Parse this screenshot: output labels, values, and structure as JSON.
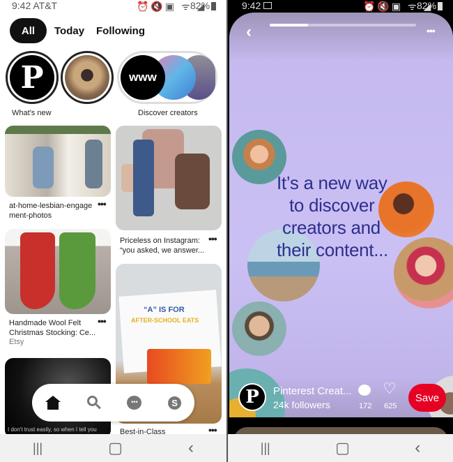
{
  "left": {
    "status": {
      "time": "9:42 AT&T",
      "battery": "82%"
    },
    "tabs": [
      {
        "label": "All",
        "active": true
      },
      {
        "label": "Today"
      },
      {
        "label": "Following"
      }
    ],
    "stories": [
      {
        "label": "What's new"
      },
      {
        "label": ""
      },
      {
        "label": "Discover creators",
        "logo_text": "www"
      }
    ],
    "pins": [
      {
        "title": "at-home-lesbian-engagement-photos",
        "line1": "at-home-lesbian-engage",
        "line2": "ment-photos"
      },
      {
        "line1": "Priceless on Instagram:",
        "line2": "“you asked, we answer..."
      },
      {
        "line1": "Handmade Wool Felt",
        "line2": "Christmas Stocking: Ce...",
        "source": "Etsy"
      },
      {
        "line1": "Best-in-Class"
      },
      {
        "caption": "I don't trust easily, so when I tell you"
      }
    ],
    "more_label": "•••",
    "card_text": {
      "a": "“A” IS FOR",
      "b": "AFTER-SCHOOL EATS"
    },
    "bottom_nav": [
      "home-icon",
      "search-icon",
      "chat-icon",
      "profile-icon"
    ],
    "profile_initial": "S"
  },
  "right": {
    "status": {
      "time": "9:42",
      "battery": "82%"
    },
    "progress": 0.26,
    "headline": [
      "It’s a new way",
      "to discover",
      "creators and",
      "their content..."
    ],
    "creator": {
      "name": "Pinterest Creat...",
      "followers": "24k followers"
    },
    "comments": "172",
    "likes": "625",
    "save_label": "Save",
    "more_label": "•••",
    "back_label": "‹",
    "colors": {
      "card_bg": "#c9bff2",
      "headline": "#2d2f8e",
      "save": "#e60023"
    }
  },
  "system_nav": {
    "recent": "|||",
    "home": "▢",
    "back": "‹"
  }
}
